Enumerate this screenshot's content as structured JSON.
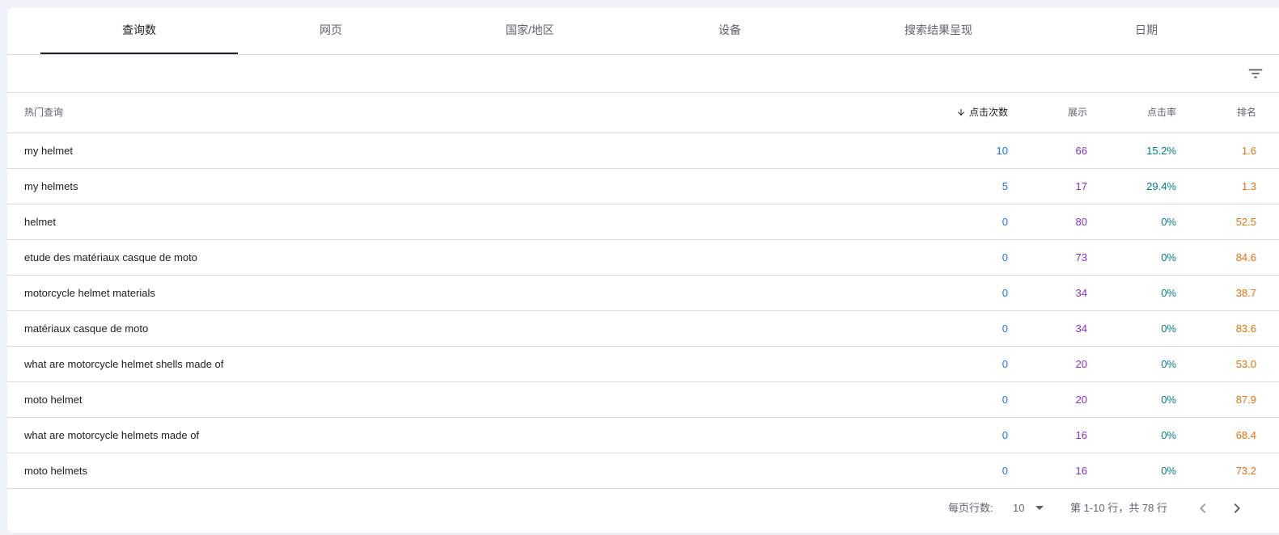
{
  "colors": {
    "clicks": "#1a73e8",
    "impressions": "#8430ce",
    "ctr": "#007b83",
    "position": "#e8710a"
  },
  "tabs": [
    {
      "label": "查询数",
      "active": true
    },
    {
      "label": "网页",
      "active": false
    },
    {
      "label": "国家/地区",
      "active": false
    },
    {
      "label": "设备",
      "active": false
    },
    {
      "label": "搜索结果呈现",
      "active": false
    },
    {
      "label": "日期",
      "active": false
    }
  ],
  "filter_icon": "filter-list-icon",
  "table": {
    "headers": {
      "query": "热门查询",
      "clicks": "点击次数",
      "impressions": "展示",
      "ctr": "点击率",
      "position": "排名"
    },
    "sort_icon": "arrow-downward-icon",
    "rows": [
      {
        "query": "my helmet",
        "clicks": "10",
        "impressions": "66",
        "ctr": "15.2%",
        "position": "1.6"
      },
      {
        "query": "my helmets",
        "clicks": "5",
        "impressions": "17",
        "ctr": "29.4%",
        "position": "1.3"
      },
      {
        "query": "helmet",
        "clicks": "0",
        "impressions": "80",
        "ctr": "0%",
        "position": "52.5"
      },
      {
        "query": "etude des matériaux casque de moto",
        "clicks": "0",
        "impressions": "73",
        "ctr": "0%",
        "position": "84.6"
      },
      {
        "query": "motorcycle helmet materials",
        "clicks": "0",
        "impressions": "34",
        "ctr": "0%",
        "position": "38.7"
      },
      {
        "query": "matériaux casque de moto",
        "clicks": "0",
        "impressions": "34",
        "ctr": "0%",
        "position": "83.6"
      },
      {
        "query": "what are motorcycle helmet shells made of",
        "clicks": "0",
        "impressions": "20",
        "ctr": "0%",
        "position": "53.0"
      },
      {
        "query": "moto helmet",
        "clicks": "0",
        "impressions": "20",
        "ctr": "0%",
        "position": "87.9"
      },
      {
        "query": "what are motorcycle helmets made of",
        "clicks": "0",
        "impressions": "16",
        "ctr": "0%",
        "position": "68.4"
      },
      {
        "query": "moto helmets",
        "clicks": "0",
        "impressions": "16",
        "ctr": "0%",
        "position": "73.2"
      }
    ]
  },
  "footer": {
    "rows_per_page_label": "每页行数:",
    "rows_per_page_value": "10",
    "range_text": "第 1-10 行，共 78 行",
    "prev_icon": "chevron-left-icon",
    "next_icon": "chevron-right-icon"
  }
}
